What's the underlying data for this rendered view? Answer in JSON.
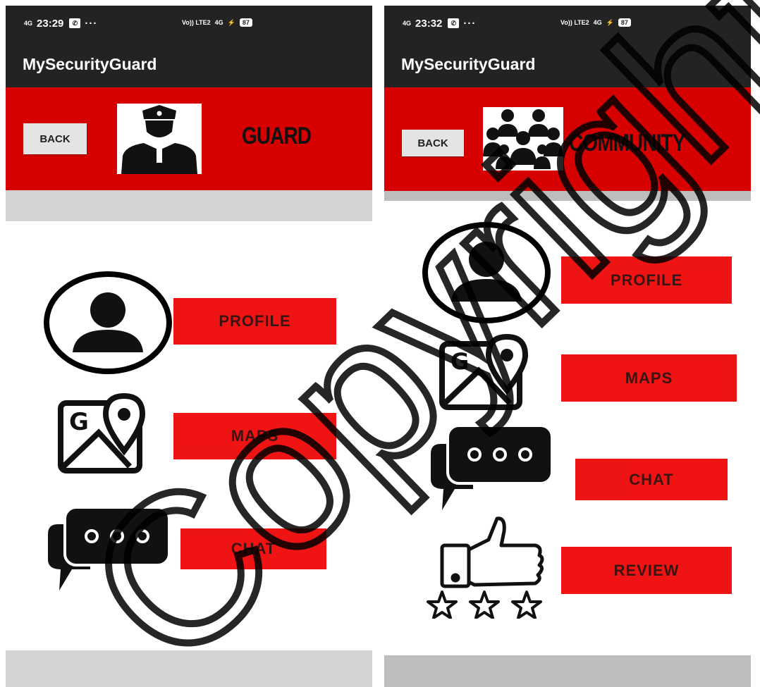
{
  "left_screen": {
    "status": {
      "signal": "4G",
      "time": "23:29",
      "dots": "···",
      "volte": "Vo)) LTE2",
      "net": "4G",
      "battery": "87"
    },
    "app_title": "MySecurityGuard",
    "back_label": "BACK",
    "header_title": "GUARD",
    "header_icon": "police-officer-icon",
    "menu": [
      {
        "label": "PROFILE",
        "icon": "user-circle-icon"
      },
      {
        "label": "MAPS",
        "icon": "google-maps-icon"
      },
      {
        "label": "CHAT",
        "icon": "chat-bubbles-icon"
      }
    ]
  },
  "right_screen": {
    "status": {
      "signal": "4G",
      "time": "23:32",
      "dots": "···",
      "volte": "Vo)) LTE2",
      "net": "4G",
      "battery": "87"
    },
    "app_title": "MySecurityGuard",
    "back_label": "BACK",
    "header_title": "COMMUNITY",
    "header_icon": "community-group-icon",
    "menu": [
      {
        "label": "PROFILE",
        "icon": "user-circle-icon"
      },
      {
        "label": "MAPS",
        "icon": "google-maps-icon"
      },
      {
        "label": "CHAT",
        "icon": "chat-bubbles-icon"
      },
      {
        "label": "REVIEW",
        "icon": "thumbs-up-stars-icon"
      }
    ]
  },
  "watermark": "Copyright@TS",
  "colors": {
    "header_red": "#d60000",
    "button_red": "#ee0000",
    "appbar_dark": "#232323",
    "strip_grey": "#d3d3d3"
  }
}
